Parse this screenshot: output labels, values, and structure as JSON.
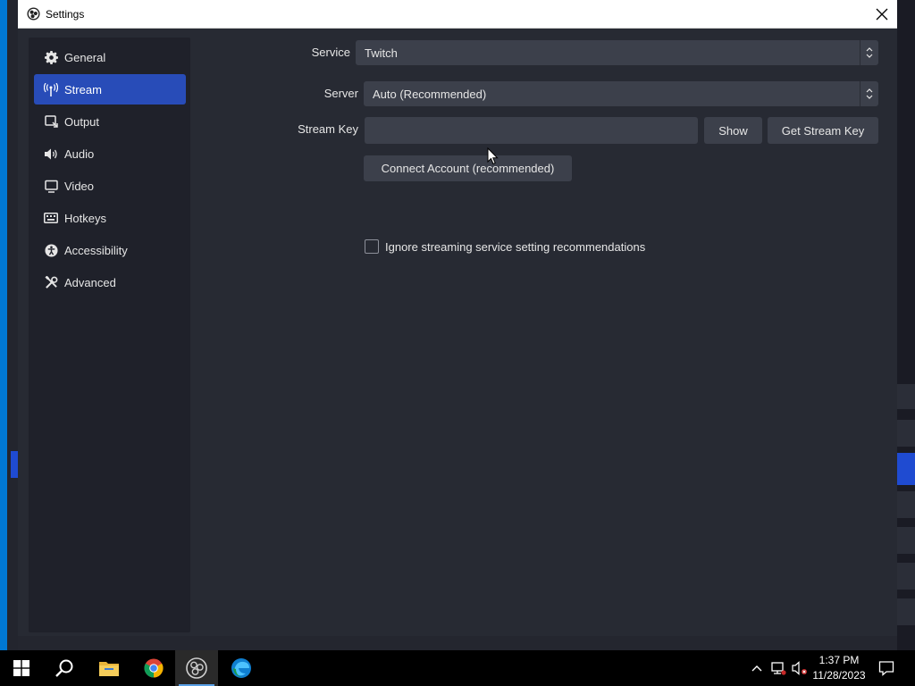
{
  "window": {
    "title": "Settings"
  },
  "sidebar": {
    "items": [
      {
        "label": "General",
        "icon": "gear-icon"
      },
      {
        "label": "Stream",
        "icon": "antenna-icon",
        "active": true
      },
      {
        "label": "Output",
        "icon": "output-icon"
      },
      {
        "label": "Audio",
        "icon": "speaker-icon"
      },
      {
        "label": "Video",
        "icon": "monitor-icon"
      },
      {
        "label": "Hotkeys",
        "icon": "keyboard-icon"
      },
      {
        "label": "Accessibility",
        "icon": "accessibility-icon"
      },
      {
        "label": "Advanced",
        "icon": "tools-icon"
      }
    ]
  },
  "stream": {
    "service_label": "Service",
    "service_value": "Twitch",
    "server_label": "Server",
    "server_value": "Auto (Recommended)",
    "stream_key_label": "Stream Key",
    "stream_key_value": "",
    "show_button": "Show",
    "get_key_button": "Get Stream Key",
    "connect_button": "Connect Account (recommended)",
    "ignore_checkbox_label": "Ignore streaming service setting recommendations",
    "ignore_checked": false
  },
  "taskbar": {
    "apps": [
      "windows-start-icon",
      "search-icon",
      "file-explorer-icon",
      "chrome-icon",
      "obs-icon",
      "edge-icon"
    ],
    "time": "1:37 PM",
    "date": "11/28/2023"
  },
  "colors": {
    "accent": "#284cb8",
    "dialog_bg": "#272a33",
    "sidebar_bg": "#1f212a",
    "control_bg": "#3c404b",
    "desktop": "#0078d4"
  }
}
